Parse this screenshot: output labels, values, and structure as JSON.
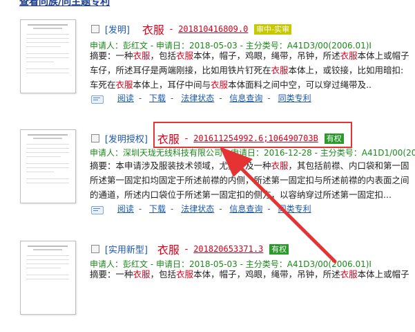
{
  "header": {
    "top_link": "查看同族/同主题专利"
  },
  "results": [
    {
      "kind": "[发明]",
      "title": "衣服",
      "number": "201810416809.0",
      "status": "审中-实审",
      "status_color": "#c8c800",
      "applicant_label": "申请人：",
      "applicant": "彭红文",
      "date_label": "申请日：",
      "date": "2018-05-03",
      "class_label": "主分类号：",
      "class": "A41D3/00(2006.01)I",
      "abstract_lines": [
        [
          {
            "t": "摘要：一种"
          },
          {
            "t": "衣服",
            "h": 1
          },
          {
            "t": "，包括"
          },
          {
            "t": "衣服",
            "h": 1
          },
          {
            "t": "本体，帽子，鸡眼，绳带，吊钟，所述"
          },
          {
            "t": "衣服",
            "h": 1
          },
          {
            "t": "本体上或帽子"
          }
        ],
        [
          {
            "t": "车仔，所述耳仔是两端刚接，比如用铁片钉死在"
          },
          {
            "t": "衣服",
            "h": 1
          },
          {
            "t": "本体上，或铰接，比如用暗扣:"
          }
        ],
        [
          {
            "t": "车死在"
          },
          {
            "t": "衣服",
            "h": 1
          },
          {
            "t": "本体上，耳仔中间与"
          },
          {
            "t": "衣服",
            "h": 1
          },
          {
            "t": "本体面料之间中空，可以穿过绳带及.."
          }
        ]
      ]
    },
    {
      "kind": "[发明授权]",
      "title": "衣服",
      "number": "201611254992.6;106490703B",
      "status": "有权",
      "status_color": "#2a9a2a",
      "applicant_label": "申请人：",
      "applicant": "深圳天珑无线科技有限公司",
      "date_label": "申请日：",
      "date": "2016-12-28",
      "class_label": "主分类号：",
      "class": "A41D1/00(20",
      "abstract_lines": [
        [
          {
            "t": "摘要：本申请涉及服装技术领域，尤其涉及一种"
          },
          {
            "t": "衣服",
            "h": 1
          },
          {
            "t": "，其包括前襟、内口袋和第一固"
          }
        ],
        [
          {
            "t": "所述第一固定扣均固定于所述前襟的内侧，所述第一固定扣与所述前襟的内表面之间"
          }
        ],
        [
          {
            "t": "的通道，所述内口袋位于所述第一固定扣的侧方，以容纳穿过所述第一固定扣..."
          }
        ]
      ]
    },
    {
      "kind": "[实用新型]",
      "title": "衣服",
      "number": "201820653371.3",
      "status": "有权",
      "status_color": "#2a9a2a",
      "applicant_label": "申请人：",
      "applicant": "彭红文",
      "date_label": "申请日：",
      "date": "2018-05-03",
      "class_label": "主分类号：",
      "class": "A41D3/00(2006.01)I",
      "abstract_lines": [
        [
          {
            "t": "摘要：一种"
          },
          {
            "t": "衣服",
            "h": 1
          },
          {
            "t": "，包括"
          },
          {
            "t": "衣服",
            "h": 1
          },
          {
            "t": "本体，帽子，鸡眼，绳带，吊钟，所述"
          },
          {
            "t": "衣服",
            "h": 1
          },
          {
            "t": "本体上或帽子"
          }
        ]
      ]
    }
  ],
  "actions": {
    "read": "阅读",
    "download": "下载",
    "legal": "法律状态",
    "info": "信息查询",
    "family": "同类专利"
  },
  "annotation": {
    "box_color": "#e53333"
  }
}
